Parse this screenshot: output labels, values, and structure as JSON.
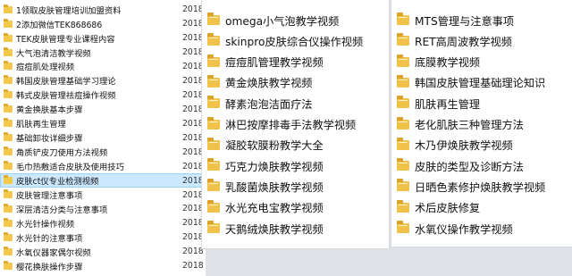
{
  "panel_left": {
    "items": [
      {
        "name": "1领取皮肤管理培训加盟资料",
        "date": "2018"
      },
      {
        "name": "2添加微信TEK868686",
        "date": "2018"
      },
      {
        "name": "TEK皮肤管理专业课程内容",
        "date": "2018"
      },
      {
        "name": "大气泡清洁教学视频",
        "date": "2018"
      },
      {
        "name": "痘痘肌处理视频",
        "date": "2018"
      },
      {
        "name": "韩国皮肤管理基础学习理论",
        "date": "2018"
      },
      {
        "name": "韩式皮肤管理祛痘操作视频",
        "date": "2018"
      },
      {
        "name": "黄金换肤基本步骤",
        "date": "2018"
      },
      {
        "name": "肌肤再生管理",
        "date": "2018"
      },
      {
        "name": "基础卸妆详细步骤",
        "date": "2018"
      },
      {
        "name": "角质铲皮刀使用方法视频",
        "date": "2018"
      },
      {
        "name": "毛巾热敷适合皮肤及使用技巧",
        "date": "2018"
      },
      {
        "name": "皮肤ct仪专业检测视频",
        "date": "2018"
      },
      {
        "name": "皮肤管理注意事项",
        "date": "2018"
      },
      {
        "name": "深层清洁分类与注意事项",
        "date": "2018"
      },
      {
        "name": "水光针操作视频",
        "date": "2018"
      },
      {
        "name": "水光针的注意事项",
        "date": "2018"
      },
      {
        "name": "水氧仪器家偶尔视频",
        "date": "2018"
      },
      {
        "name": "樱花换肤操作步骤",
        "date": "2018"
      }
    ]
  },
  "panel_middle": {
    "items": [
      "omega小气泡教学视频",
      "skinpro皮肤综合仪操作视频",
      "痘痘肌管理教学视频",
      "黄金焕肤教学视频",
      "酵素泡泡洁面疗法",
      "淋巴按摩排毒手法教学视频",
      "凝胶软膜粉教学大全",
      "巧克力焕肤教学视频",
      "乳酸菌焕肤教学视频",
      "水光充电宝教学视频",
      "天鹅绒焕肤教学视频"
    ]
  },
  "panel_right": {
    "items": [
      "MTS管理与注意事项",
      "RET高周波教学视频",
      "底膜教学视频",
      "韩国皮肤管理基础理论知识",
      "肌肤再生管理",
      "老化肌肤三种管理方法",
      "木乃伊焕肤教学视频",
      "皮肤的类型及诊断方法",
      "日晒色素修护焕肤教学视频",
      "术后皮肤修复",
      "水氧仪操作教学视频"
    ]
  }
}
